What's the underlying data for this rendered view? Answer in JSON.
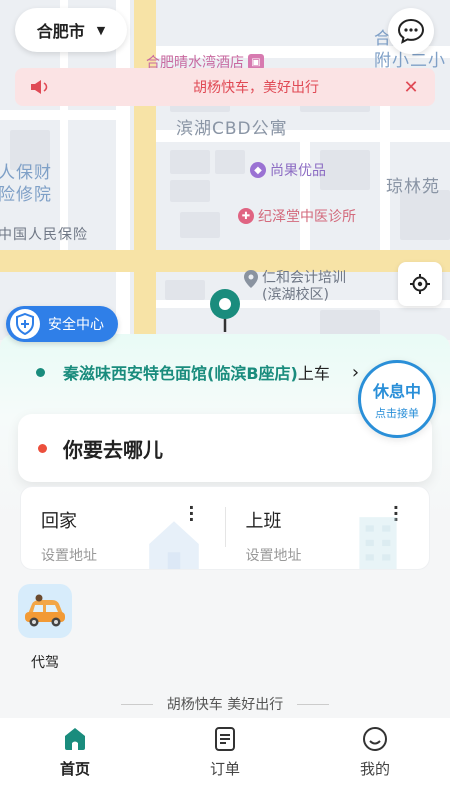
{
  "map": {
    "city": "合肥市",
    "labels": {
      "hotel": "合肥晴水湾酒店",
      "cbd": "滨湖CBD公寓",
      "shop": "尚果优品",
      "clinic": "纪泽堂中医诊所",
      "training_line1": "仁和会计培训",
      "training_line2": "(滨湖校区)",
      "insurance": "中国人民保险",
      "hospital_line1": "人保财",
      "hospital_line2": "险修院",
      "garden": "琼林苑",
      "school_line1": "合肥第",
      "school_line2": "附小二小"
    }
  },
  "notice": {
    "text": "胡杨快车，美好出行"
  },
  "safety": {
    "label": "安全中心"
  },
  "pickup": {
    "address": "秦滋味西安特色面馆(临滨B座店)",
    "suffix": "上车"
  },
  "status_button": {
    "title": "休息中",
    "subtitle": "点击接单"
  },
  "destination": {
    "prompt": "你要去哪儿"
  },
  "places": [
    {
      "title": "回家",
      "subtitle": "设置地址"
    },
    {
      "title": "上班",
      "subtitle": "设置地址"
    }
  ],
  "services": [
    {
      "label": "代驾"
    }
  ],
  "footer_slogan": "胡杨快车 美好出行",
  "tabs": [
    {
      "label": "首页",
      "active": true
    },
    {
      "label": "订单",
      "active": false
    },
    {
      "label": "我的",
      "active": false
    }
  ],
  "colors": {
    "primary": "#1a8c7d",
    "notice_text": "#e04a55",
    "status_blue": "#2a8fd8",
    "safety_blue": "#2f7fe8"
  }
}
